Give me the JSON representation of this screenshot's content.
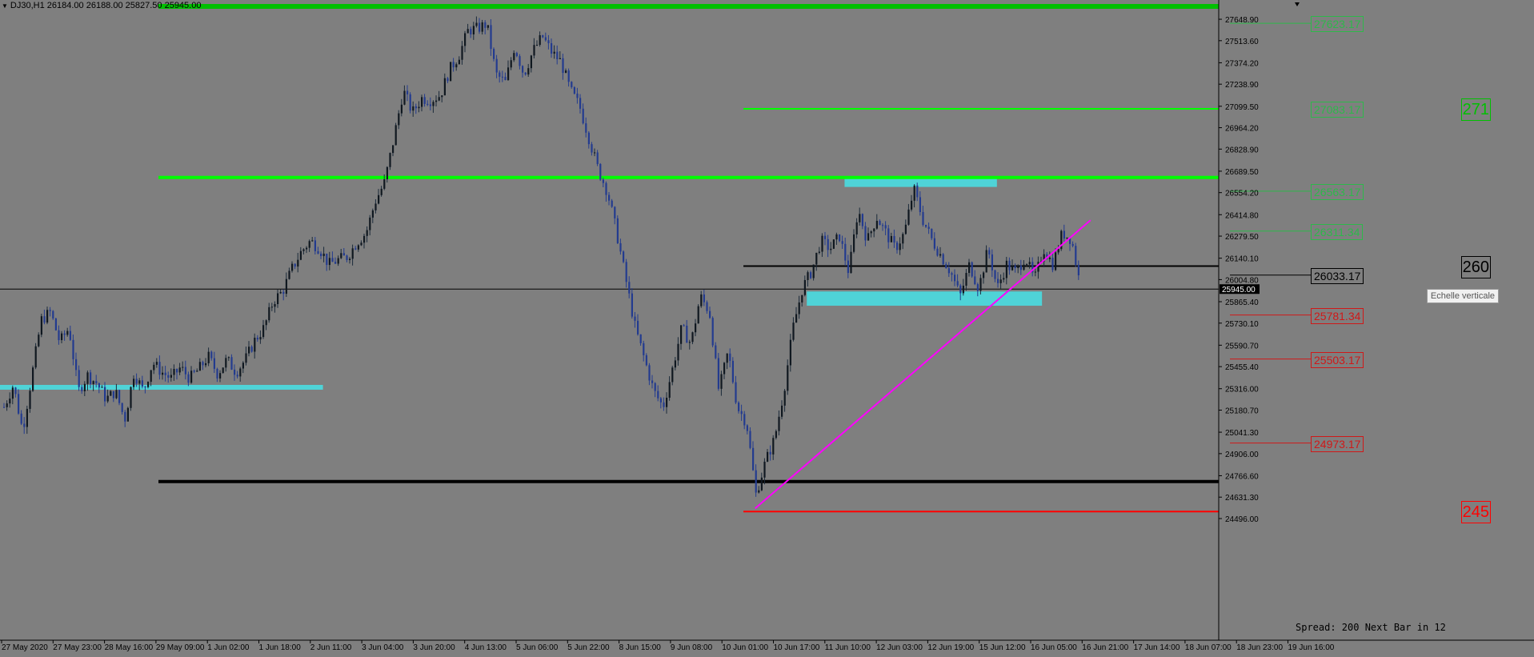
{
  "window": {
    "symbol_info": "DJ30,H1  26184.00 26188.00 25827.50 25945.00",
    "status_text": "Spread: 200 Next Bar in 12",
    "tooltip": "Echelle verticale"
  },
  "colors": {
    "background": "#7f7f7f",
    "candle_up": "#1b2a3a",
    "candle_down": "#233b8f",
    "support_zone": "#4fd3d7",
    "green_line": "#00ff00",
    "red_line": "#ff0000",
    "trendline": "#ff00ff",
    "black_line": "#000000"
  },
  "chart_data": {
    "type": "candlestick",
    "symbol": "DJ30",
    "timeframe": "H1",
    "ohlc_header": {
      "open": 26184.0,
      "high": 26188.0,
      "low": 25827.5,
      "close": 25945.0
    },
    "current_price": 25945.0,
    "current_price_label": "25945.00",
    "ylim": [
      24496.0,
      27730.0
    ],
    "y_ticks": [
      "27648.90",
      "27513.60",
      "27374.20",
      "27238.90",
      "27099.50",
      "26964.20",
      "26828.90",
      "26689.50",
      "26554.20",
      "26414.80",
      "26279.50",
      "26140.10",
      "26004.80",
      "25865.40",
      "25730.10",
      "25590.70",
      "25455.40",
      "25316.00",
      "25180.70",
      "25041.30",
      "24906.00",
      "24766.60",
      "24631.30",
      "24496.00"
    ],
    "x_ticks": [
      "27 May 2020",
      "27 May 23:00",
      "28 May 16:00",
      "29 May 09:00",
      "1 Jun 02:00",
      "1 Jun 18:00",
      "2 Jun 11:00",
      "3 Jun 04:00",
      "3 Jun 20:00",
      "4 Jun 13:00",
      "5 Jun 06:00",
      "5 Jun 22:00",
      "8 Jun 15:00",
      "9 Jun 08:00",
      "10 Jun 01:00",
      "10 Jun 17:00",
      "11 Jun 10:00",
      "12 Jun 03:00",
      "12 Jun 19:00",
      "15 Jun 12:00",
      "16 Jun 05:00",
      "16 Jun 21:00",
      "17 Jun 14:00",
      "18 Jun 07:00",
      "18 Jun 23:00",
      "19 Jun 16:00"
    ],
    "price_path": [
      [
        0,
        25200
      ],
      [
        1,
        25340
      ],
      [
        2,
        25050
      ],
      [
        3,
        25400
      ],
      [
        4,
        25750
      ],
      [
        5,
        25800
      ],
      [
        6,
        25610
      ],
      [
        7,
        25700
      ],
      [
        8,
        25300
      ],
      [
        9,
        25400
      ],
      [
        10,
        25350
      ],
      [
        11,
        25250
      ],
      [
        12,
        25300
      ],
      [
        13,
        25120
      ],
      [
        14,
        25420
      ],
      [
        15,
        25300
      ],
      [
        16,
        25480
      ],
      [
        17,
        25420
      ],
      [
        18,
        25380
      ],
      [
        19,
        25450
      ],
      [
        20,
        25380
      ],
      [
        21,
        25440
      ],
      [
        22,
        25520
      ],
      [
        23,
        25410
      ],
      [
        24,
        25500
      ],
      [
        25,
        25420
      ],
      [
        26,
        25500
      ],
      [
        27,
        25620
      ],
      [
        28,
        25700
      ],
      [
        29,
        25870
      ],
      [
        30,
        25930
      ],
      [
        31,
        26070
      ],
      [
        32,
        26180
      ],
      [
        33,
        26250
      ],
      [
        34,
        26200
      ],
      [
        35,
        26100
      ],
      [
        36,
        26130
      ],
      [
        37,
        26150
      ],
      [
        38,
        26240
      ],
      [
        39,
        26300
      ],
      [
        40,
        26500
      ],
      [
        41,
        26620
      ],
      [
        42,
        26900
      ],
      [
        43,
        27200
      ],
      [
        44,
        27060
      ],
      [
        45,
        27150
      ],
      [
        46,
        27140
      ],
      [
        47,
        27170
      ],
      [
        48,
        27330
      ],
      [
        49,
        27420
      ],
      [
        50,
        27580
      ],
      [
        51,
        27590
      ],
      [
        52,
        27620
      ],
      [
        53,
        27300
      ],
      [
        54,
        27250
      ],
      [
        55,
        27480
      ],
      [
        56,
        27300
      ],
      [
        57,
        27450
      ],
      [
        58,
        27540
      ],
      [
        59,
        27440
      ],
      [
        60,
        27380
      ],
      [
        61,
        27200
      ],
      [
        62,
        27100
      ],
      [
        63,
        26900
      ],
      [
        64,
        26700
      ],
      [
        65,
        26560
      ],
      [
        66,
        26300
      ],
      [
        67,
        26000
      ],
      [
        68,
        25700
      ],
      [
        69,
        25500
      ],
      [
        70,
        25300
      ],
      [
        71,
        25200
      ],
      [
        72,
        25440
      ],
      [
        73,
        25700
      ],
      [
        74,
        25600
      ],
      [
        75,
        25900
      ],
      [
        76,
        25800
      ],
      [
        77,
        25300
      ],
      [
        78,
        25550
      ],
      [
        79,
        25200
      ],
      [
        80,
        25100
      ],
      [
        81,
        24650
      ],
      [
        82,
        24850
      ],
      [
        83,
        25000
      ],
      [
        84,
        25300
      ],
      [
        85,
        25700
      ],
      [
        86,
        25950
      ],
      [
        87,
        26060
      ],
      [
        88,
        26250
      ],
      [
        89,
        26200
      ],
      [
        90,
        26280
      ],
      [
        91,
        26050
      ],
      [
        92,
        26450
      ],
      [
        93,
        26250
      ],
      [
        94,
        26400
      ],
      [
        95,
        26300
      ],
      [
        96,
        26200
      ],
      [
        97,
        26300
      ],
      [
        98,
        26580
      ],
      [
        99,
        26380
      ],
      [
        100,
        26250
      ],
      [
        101,
        26150
      ],
      [
        102,
        26050
      ],
      [
        103,
        25900
      ],
      [
        104,
        26100
      ],
      [
        105,
        25950
      ],
      [
        106,
        26200
      ],
      [
        107,
        25950
      ],
      [
        108,
        26100
      ],
      [
        109,
        26050
      ],
      [
        110,
        26150
      ],
      [
        111,
        26000
      ],
      [
        112,
        26200
      ],
      [
        113,
        26100
      ],
      [
        114,
        26300
      ],
      [
        115,
        26260
      ],
      [
        116,
        25945
      ]
    ],
    "horizontal_lines": [
      {
        "price": 27730.0,
        "color": "#00c000",
        "start": 0.13,
        "width": 6
      },
      {
        "price": 27083.17,
        "color": "#00ff00",
        "start": 0.61,
        "width": 2
      },
      {
        "price": 26650.0,
        "color": "#00ff00",
        "start": 0.13,
        "width": 4
      },
      {
        "price": 26090.0,
        "color": "#000000",
        "start": 0.61,
        "width": 2
      },
      {
        "price": 24730.0,
        "color": "#000000",
        "start": 0.13,
        "width": 4
      },
      {
        "price": 24540.0,
        "color": "#ff0000",
        "start": 0.61,
        "width": 2
      },
      {
        "price": 25945.0,
        "color": "#000000",
        "start": 0.0,
        "width": 1
      }
    ],
    "zones": [
      {
        "price_top": 25340.0,
        "price_bottom": 25320.0,
        "x_start": 0,
        "x_end": 0.265,
        "color": "#4fd3d7"
      },
      {
        "price_top": 26650.0,
        "price_bottom": 26590.0,
        "x_start": 0.693,
        "x_end": 0.818,
        "color": "#4fd3d7"
      },
      {
        "price_top": 25930.0,
        "price_bottom": 25840.0,
        "x_start": 0.662,
        "x_end": 0.855,
        "color": "#4fd3d7"
      }
    ],
    "trendline": {
      "from": [
        81,
        24560
      ],
      "to": [
        118,
        26380
      ],
      "color": "#ff00ff"
    },
    "level_labels": [
      {
        "text": "27623.17",
        "price": 27623.17,
        "color": "#2db84a",
        "tick": true
      },
      {
        "text": "27083.17",
        "price": 27083.17,
        "color": "#2db84a",
        "tick": false
      },
      {
        "text": "26563.17",
        "price": 26563.17,
        "color": "#2db84a",
        "tick": true
      },
      {
        "text": "26311.34",
        "price": 26311.34,
        "color": "#2db84a",
        "tick": true
      },
      {
        "text": "26033.17",
        "price": 26033.17,
        "color": "#000000",
        "tick": true
      },
      {
        "text": "25781.34",
        "price": 25781.34,
        "color": "#d01818",
        "tick": true
      },
      {
        "text": "25503.17",
        "price": 25503.17,
        "color": "#d01818",
        "tick": true
      },
      {
        "text": "24973.17",
        "price": 24973.17,
        "color": "#d01818",
        "tick": true
      }
    ],
    "edge_labels": [
      {
        "text": "271",
        "price": 27083.17,
        "color": "#00c000"
      },
      {
        "text": "260",
        "price": 26090.0,
        "color": "#000000"
      },
      {
        "text": "245",
        "price": 24540.0,
        "color": "#ff0000"
      }
    ]
  }
}
